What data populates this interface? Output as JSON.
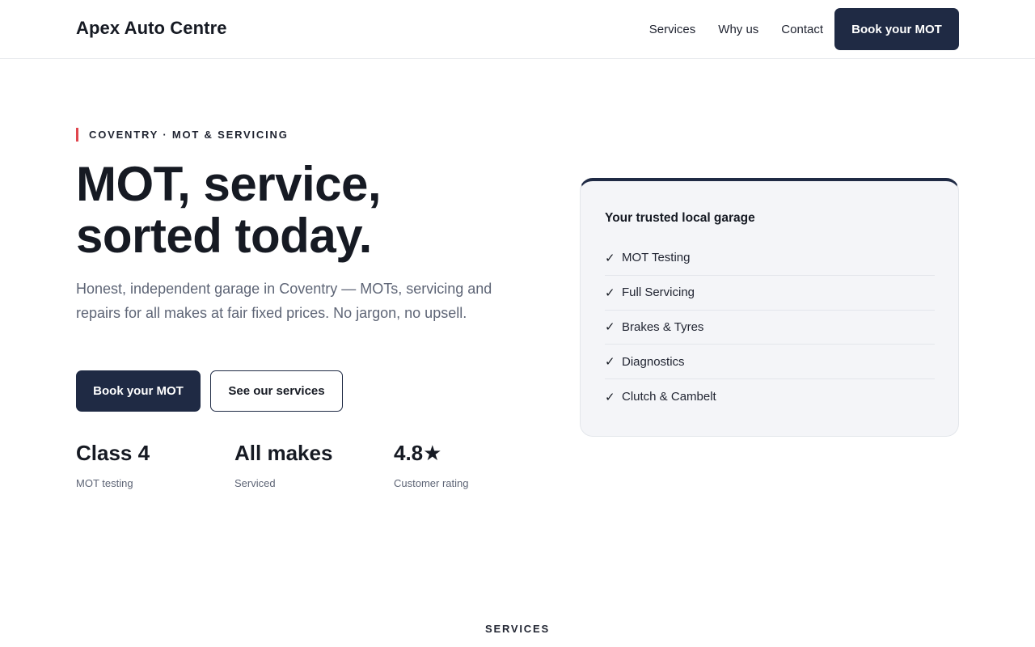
{
  "header": {
    "brand": "Apex Auto Centre",
    "nav": [
      "Services",
      "Why us",
      "Contact"
    ],
    "cta_label": "Book your MOT"
  },
  "hero": {
    "eyebrow": "COVENTRY · MOT & SERVICING",
    "title_line1": "MOT, service,",
    "title_line2": "sorted today.",
    "subtitle": "Honest, independent garage in Coventry — MOTs, servicing and repairs for all makes at fair fixed prices. No jargon, no upsell.",
    "primary_cta": "Book your MOT",
    "secondary_cta": "See our services",
    "stats": [
      {
        "value": "Class 4",
        "label": "MOT testing"
      },
      {
        "value": "All makes",
        "label": "Serviced"
      },
      {
        "value": "4.8★",
        "label": "Customer rating"
      }
    ]
  },
  "card": {
    "title": "Your trusted local garage",
    "check_glyph": "✓",
    "items": [
      "MOT Testing",
      "Full Servicing",
      "Brakes & Tyres",
      "Diagnostics",
      "Clutch & Cambelt"
    ]
  },
  "services_section": {
    "label": "SERVICES"
  },
  "colors": {
    "accent_navy": "#1f2a44",
    "eyebrow_bar": "#e0464e",
    "muted_text": "#5e6576",
    "card_bg": "#f4f5f8"
  }
}
